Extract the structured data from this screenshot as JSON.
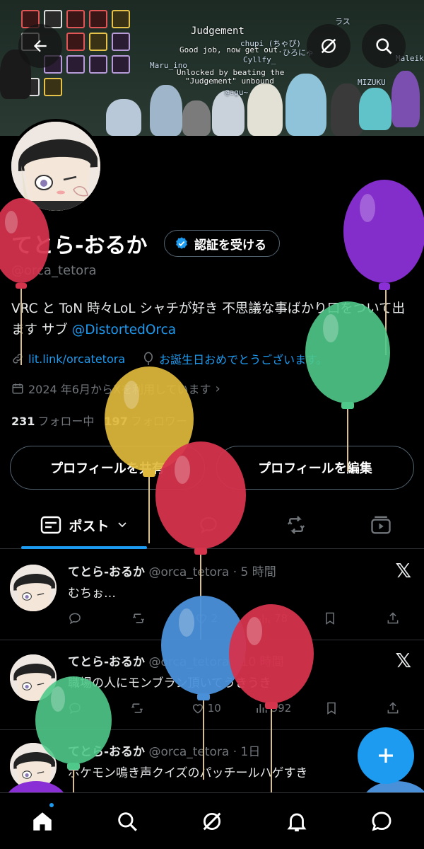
{
  "banner": {
    "title": "Judgement",
    "line1": "Good job, now get out.",
    "line2": "Unlocked by beating the",
    "line3": "\"Judgement\" unbound",
    "names": [
      "Maru_ino",
      "chupi (ちゃぴ)",
      "Cyllfy_",
      "@agu~",
      "ひろにゃ",
      "Maleiki",
      "MIZUKU",
      "ラス"
    ]
  },
  "header": {
    "back_icon": "back-arrow-icon",
    "grok_icon": "grok-icon",
    "search_icon": "search-icon"
  },
  "profile": {
    "name": "てとら-おるか",
    "verify_button": "認証を受ける",
    "handle": "@orca_tetora",
    "bio_text": "VRC と ToN 時々LoL シャチが好き 不思議な事ばかり口をついて出ます サブ ",
    "bio_link": "@DistortedOrca",
    "website": "lit.link/orcatetora",
    "birthday": "お誕生日おめでとうございます。",
    "joined": "2024 年6月からXを利用しています",
    "following_count": "231",
    "following_label": "フォロー中",
    "followers_count": "197",
    "followers_label": "フォロワー",
    "share_button": "プロフィールを共有",
    "edit_button": "プロフィールを編集"
  },
  "tabs": {
    "posts_label": "ポスト"
  },
  "posts": [
    {
      "name": "てとら-おるか",
      "meta": "@orca_tetora · 5 時間",
      "text": "むちぉ…",
      "retweets": "",
      "likes": "2",
      "views": "78"
    },
    {
      "name": "てとら-おるか",
      "meta": "@orca_tetora · 10 時間",
      "text": "職場の人にモンブラン頂いてうきうき",
      "retweets": "",
      "likes": "10",
      "views": "592"
    },
    {
      "name": "てとら-おるか",
      "meta": "@orca_tetora · 1日",
      "text": "ポケモン鳴き声クイズのパッチールハゲすき",
      "retweets": "",
      "likes": "",
      "views": ""
    }
  ],
  "colors": {
    "accent": "#1d9bf0",
    "background": "#000000",
    "muted": "#71767b"
  }
}
